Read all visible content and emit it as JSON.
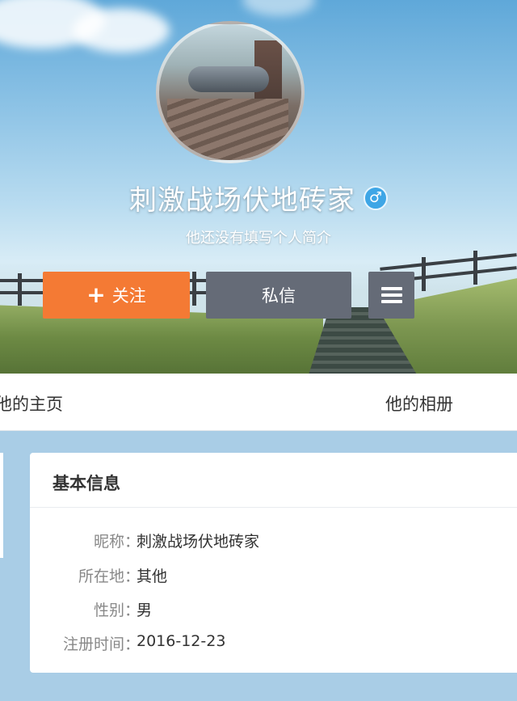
{
  "profile": {
    "nickname": "刺激战场伏地砖家",
    "gender_symbol": "♂",
    "bio": "他还没有填写个人简介"
  },
  "actions": {
    "follow_icon": "+",
    "follow_label": "关注",
    "message_label": "私信",
    "menu_icon": "menu-icon"
  },
  "tabs": [
    {
      "label": "他的主页"
    },
    {
      "label": "他的相册"
    }
  ],
  "info_card": {
    "title": "基本信息",
    "rows": [
      {
        "label": "昵称：",
        "value": "刺激战场伏地砖家"
      },
      {
        "label": "所在地：",
        "value": "其他"
      },
      {
        "label": "性别：",
        "value": "男"
      },
      {
        "label": "注册时间：",
        "value": "2016-12-23"
      }
    ]
  },
  "colors": {
    "follow_button": "#f47a34",
    "secondary_button": "#656b77",
    "gender_badge": "#3ea6e6",
    "page_background": "#a9cde6"
  }
}
